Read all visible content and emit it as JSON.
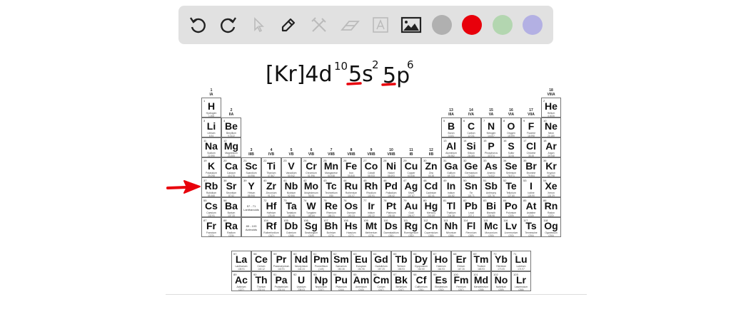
{
  "toolbar": {
    "tools": [
      "undo-icon",
      "redo-icon",
      "select-pointer-icon",
      "pencil-icon",
      "tools-icon",
      "eraser-icon",
      "text-icon",
      "image-icon"
    ],
    "colors": [
      "#b0b0b0",
      "#e8000b",
      "#b3d6b0",
      "#b3b0e3"
    ]
  },
  "annotation": {
    "base": "[Kr]4d",
    "d_sup": "10",
    "s_part": "5s",
    "s_sup": "2",
    "p_part": "5p",
    "p_sup": "6",
    "ink_color": "#111111",
    "highlight_color": "#e8000b"
  },
  "group_labels": [
    [
      "1",
      "IA"
    ],
    [
      "2",
      "IIA"
    ],
    [
      "3",
      "IIIB"
    ],
    [
      "4",
      "IVB"
    ],
    [
      "5",
      "VB"
    ],
    [
      "6",
      "VIB"
    ],
    [
      "7",
      "VIIB"
    ],
    [
      "8",
      "VIIIB"
    ],
    [
      "9",
      "VIIIB"
    ],
    [
      "10",
      "VIIIB"
    ],
    [
      "11",
      "IB"
    ],
    [
      "12",
      "IIB"
    ],
    [
      "13",
      "IIIA"
    ],
    [
      "14",
      "IVA"
    ],
    [
      "15",
      "VA"
    ],
    [
      "16",
      "VIA"
    ],
    [
      "17",
      "VIIA"
    ],
    [
      "18",
      "VIIIA"
    ]
  ],
  "placeholders": {
    "lanthanoids": [
      "57 - 71",
      "Lanthanoids"
    ],
    "actinoids": [
      "89 - 103",
      "Actinoids"
    ]
  },
  "elements": [
    [
      1,
      "H",
      "Hydrogen",
      "1.008"
    ],
    [
      2,
      "He",
      "Helium",
      "4.0026"
    ],
    [
      3,
      "Li",
      "Lithium",
      "6.94"
    ],
    [
      4,
      "Be",
      "Beryllium",
      "9.0122"
    ],
    [
      5,
      "B",
      "Boron",
      "10.81"
    ],
    [
      6,
      "C",
      "Carbon",
      "12.011"
    ],
    [
      7,
      "N",
      "Nitrogen",
      "14.007"
    ],
    [
      8,
      "O",
      "Oxygen",
      "15.999"
    ],
    [
      9,
      "F",
      "Fluorine",
      "18.998"
    ],
    [
      10,
      "Ne",
      "Neon",
      "20.180"
    ],
    [
      11,
      "Na",
      "Sodium",
      "22.990"
    ],
    [
      12,
      "Mg",
      "Magnesium",
      "24.305"
    ],
    [
      13,
      "Al",
      "Aluminium",
      "26.982"
    ],
    [
      14,
      "Si",
      "Silicon",
      "28.085"
    ],
    [
      15,
      "P",
      "Phosphorus",
      "30.974"
    ],
    [
      16,
      "S",
      "Sulfur",
      "32.06"
    ],
    [
      17,
      "Cl",
      "Chlorine",
      "35.45"
    ],
    [
      18,
      "Ar",
      "Argon",
      "39.948"
    ],
    [
      19,
      "K",
      "Potassium",
      "39.098"
    ],
    [
      20,
      "Ca",
      "Calcium",
      "40.078"
    ],
    [
      21,
      "Sc",
      "Scandium",
      "44.956"
    ],
    [
      22,
      "Ti",
      "Titanium",
      "47.867"
    ],
    [
      23,
      "V",
      "Vanadium",
      "50.942"
    ],
    [
      24,
      "Cr",
      "Chromium",
      "51.996"
    ],
    [
      25,
      "Mn",
      "Manganese",
      "54.938"
    ],
    [
      26,
      "Fe",
      "Iron",
      "55.845"
    ],
    [
      27,
      "Co",
      "Cobalt",
      "58.933"
    ],
    [
      28,
      "Ni",
      "Nickel",
      "58.693"
    ],
    [
      29,
      "Cu",
      "Copper",
      "63.546"
    ],
    [
      30,
      "Zn",
      "Zinc",
      "65.38"
    ],
    [
      31,
      "Ga",
      "Gallium",
      "69.723"
    ],
    [
      32,
      "Ge",
      "Germanium",
      "72.630"
    ],
    [
      33,
      "As",
      "Arsenic",
      "74.922"
    ],
    [
      34,
      "Se",
      "Selenium",
      "78.971"
    ],
    [
      35,
      "Br",
      "Bromine",
      "79.904"
    ],
    [
      36,
      "Kr",
      "Krypton",
      "83.798"
    ],
    [
      37,
      "Rb",
      "Rubidium",
      "85.468"
    ],
    [
      38,
      "Sr",
      "Strontium",
      "87.62"
    ],
    [
      39,
      "Y",
      "Yttrium",
      "88.906"
    ],
    [
      40,
      "Zr",
      "Zirconium",
      "91.224"
    ],
    [
      41,
      "Nb",
      "Niobium",
      "92.906"
    ],
    [
      42,
      "Mo",
      "Molybdenum",
      "95.95"
    ],
    [
      43,
      "Tc",
      "Technetium",
      "(98)"
    ],
    [
      44,
      "Ru",
      "Ruthenium",
      "101.07"
    ],
    [
      45,
      "Rh",
      "Rhodium",
      "102.91"
    ],
    [
      46,
      "Pd",
      "Palladium",
      "106.42"
    ],
    [
      47,
      "Ag",
      "Silver",
      "107.87"
    ],
    [
      48,
      "Cd",
      "Cadmium",
      "112.41"
    ],
    [
      49,
      "In",
      "Indium",
      "114.82"
    ],
    [
      50,
      "Sn",
      "Tin",
      "118.71"
    ],
    [
      51,
      "Sb",
      "Antimony",
      "121.76"
    ],
    [
      52,
      "Te",
      "Tellurium",
      "127.60"
    ],
    [
      53,
      "I",
      "Iodine",
      "126.90"
    ],
    [
      54,
      "Xe",
      "Xenon",
      "131.29"
    ],
    [
      55,
      "Cs",
      "Caesium",
      "132.91"
    ],
    [
      56,
      "Ba",
      "Barium",
      "137.33"
    ],
    [
      57,
      "La",
      "Lanthanum",
      "138.91"
    ],
    [
      58,
      "Ce",
      "Cerium",
      "140.12"
    ],
    [
      59,
      "Pr",
      "Praseodymium",
      "140.91"
    ],
    [
      60,
      "Nd",
      "Neodymium",
      "144.24"
    ],
    [
      61,
      "Pm",
      "Promethium",
      "(145)"
    ],
    [
      62,
      "Sm",
      "Samarium",
      "150.36"
    ],
    [
      63,
      "Eu",
      "Europium",
      "151.96"
    ],
    [
      64,
      "Gd",
      "Gadolinium",
      "157.25"
    ],
    [
      65,
      "Tb",
      "Terbium",
      "158.93"
    ],
    [
      66,
      "Dy",
      "Dysprosium",
      "162.50"
    ],
    [
      67,
      "Ho",
      "Holmium",
      "164.93"
    ],
    [
      68,
      "Er",
      "Erbium",
      "167.26"
    ],
    [
      69,
      "Tm",
      "Thulium",
      "168.93"
    ],
    [
      70,
      "Yb",
      "Ytterbium",
      "173.05"
    ],
    [
      71,
      "Lu",
      "Lutetium",
      "174.97"
    ],
    [
      72,
      "Hf",
      "Hafnium",
      "178.49"
    ],
    [
      73,
      "Ta",
      "Tantalum",
      "180.95"
    ],
    [
      74,
      "W",
      "Tungsten",
      "183.84"
    ],
    [
      75,
      "Re",
      "Rhenium",
      "186.21"
    ],
    [
      76,
      "Os",
      "Osmium",
      "190.23"
    ],
    [
      77,
      "Ir",
      "Iridium",
      "192.22"
    ],
    [
      78,
      "Pt",
      "Platinum",
      "195.08"
    ],
    [
      79,
      "Au",
      "Gold",
      "196.97"
    ],
    [
      80,
      "Hg",
      "Mercury",
      "200.59"
    ],
    [
      81,
      "Tl",
      "Thallium",
      "204.38"
    ],
    [
      82,
      "Pb",
      "Lead",
      "207.2"
    ],
    [
      83,
      "Bi",
      "Bismuth",
      "208.98"
    ],
    [
      84,
      "Po",
      "Polonium",
      "(209)"
    ],
    [
      85,
      "At",
      "Astatine",
      "(210)"
    ],
    [
      86,
      "Rn",
      "Radon",
      "(222)"
    ],
    [
      87,
      "Fr",
      "Francium",
      "(223)"
    ],
    [
      88,
      "Ra",
      "Radium",
      "(226)"
    ],
    [
      89,
      "Ac",
      "Actinium",
      "(227)"
    ],
    [
      90,
      "Th",
      "Thorium",
      "232.04"
    ],
    [
      91,
      "Pa",
      "Protactinium",
      "231.04"
    ],
    [
      92,
      "U",
      "Uranium",
      "238.03"
    ],
    [
      93,
      "Np",
      "Neptunium",
      "(237)"
    ],
    [
      94,
      "Pu",
      "Plutonium",
      "(244)"
    ],
    [
      95,
      "Am",
      "Americium",
      "(243)"
    ],
    [
      96,
      "Cm",
      "Curium",
      "(247)"
    ],
    [
      97,
      "Bk",
      "Berkelium",
      "(247)"
    ],
    [
      98,
      "Cf",
      "Californium",
      "(251)"
    ],
    [
      99,
      "Es",
      "Einsteinium",
      "(252)"
    ],
    [
      100,
      "Fm",
      "Fermium",
      "(257)"
    ],
    [
      101,
      "Md",
      "Mendelevium",
      "(258)"
    ],
    [
      102,
      "No",
      "Nobelium",
      "(259)"
    ],
    [
      103,
      "Lr",
      "Lawrencium",
      "(266)"
    ],
    [
      104,
      "Rf",
      "Rutherfordium",
      "(267)"
    ],
    [
      105,
      "Db",
      "Dubnium",
      "(268)"
    ],
    [
      106,
      "Sg",
      "Seaborgium",
      "(269)"
    ],
    [
      107,
      "Bh",
      "Bohrium",
      "(270)"
    ],
    [
      108,
      "Hs",
      "Hassium",
      "(277)"
    ],
    [
      109,
      "Mt",
      "Meitnerium",
      "(278)"
    ],
    [
      110,
      "Ds",
      "Darmstadtium",
      "(281)"
    ],
    [
      111,
      "Rg",
      "Roentgenium",
      "(282)"
    ],
    [
      112,
      "Cn",
      "Copernicium",
      "(285)"
    ],
    [
      113,
      "Nh",
      "Nihonium",
      "(286)"
    ],
    [
      114,
      "Fl",
      "Flerovium",
      "(289)"
    ],
    [
      115,
      "Mc",
      "Moscovium",
      "(290)"
    ],
    [
      116,
      "Lv",
      "Livermorium",
      "(293)"
    ],
    [
      117,
      "Ts",
      "Tennessine",
      "(294)"
    ],
    [
      118,
      "Og",
      "Oganesson",
      "(294)"
    ]
  ]
}
